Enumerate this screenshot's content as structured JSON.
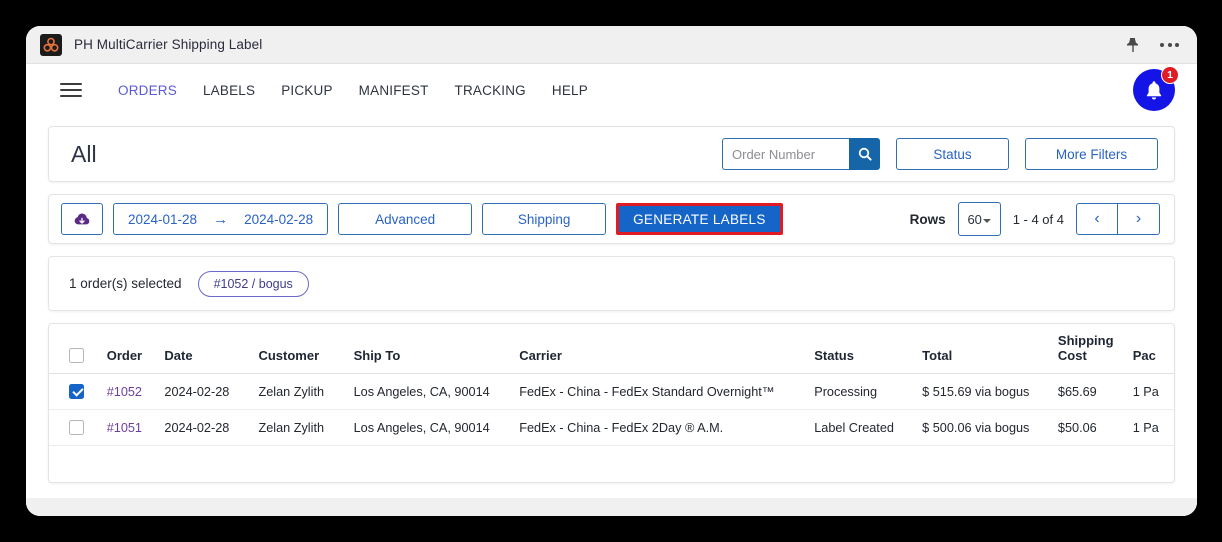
{
  "titlebar": {
    "app_icon": "trefoil-app-icon",
    "title": "PH MultiCarrier Shipping Label",
    "pin_icon": "pin-icon",
    "more_icon": "more-options-icon"
  },
  "nav": {
    "menu_icon": "hamburger-menu-icon",
    "items": [
      {
        "label": "ORDERS",
        "active": true
      },
      {
        "label": "LABELS",
        "active": false
      },
      {
        "label": "PICKUP",
        "active": false
      },
      {
        "label": "MANIFEST",
        "active": false
      },
      {
        "label": "TRACKING",
        "active": false
      },
      {
        "label": "HELP",
        "active": false
      }
    ],
    "notification": {
      "icon": "bell-icon",
      "count": "1",
      "badge_color": "#e01b24",
      "circle_color": "#1414e6"
    }
  },
  "header": {
    "page_title": "All",
    "search": {
      "placeholder": "Order Number",
      "value": "",
      "icon": "search-icon"
    },
    "status_button": "Status",
    "more_filters_button": "More Filters"
  },
  "toolbar": {
    "export_icon": "cloud-download-icon",
    "date_from": "2024-01-28",
    "date_arrow": "→",
    "date_to": "2024-02-28",
    "advanced_button": "Advanced",
    "shipping_button": "Shipping",
    "generate_labels_button": "GENERATE LABELS",
    "generate_labels_highlight_color": "#e01b24",
    "generate_labels_bg_color": "#1565c8",
    "rows_label": "Rows",
    "rows_value": "60",
    "range_text": "1 - 4 of 4",
    "prev_icon": "chevron-left-icon",
    "next_icon": "chevron-right-icon"
  },
  "selection": {
    "text": "1 order(s) selected",
    "chips": [
      {
        "label": "#1052 / bogus"
      }
    ]
  },
  "table": {
    "columns": [
      "Order",
      "Date",
      "Customer",
      "Ship To",
      "Carrier",
      "Status",
      "Total",
      "Shipping Cost",
      "Pac"
    ],
    "rows": [
      {
        "selected": true,
        "order": "#1052",
        "date": "2024-02-28",
        "customer": "Zelan Zylith",
        "ship_to": "Los Angeles, CA, 90014",
        "carrier": "FedEx - China - FedEx Standard Overnight™",
        "status": "Processing",
        "total": "$ 515.69 via bogus",
        "shipping_cost": "$65.69",
        "packages": "1 Pa"
      },
      {
        "selected": false,
        "order": "#1051",
        "date": "2024-02-28",
        "customer": "Zelan Zylith",
        "ship_to": "Los Angeles, CA, 90014",
        "carrier": "FedEx - China - FedEx 2Day ® A.M.",
        "status": "Label Created",
        "total": "$ 500.06 via bogus",
        "shipping_cost": "$50.06",
        "packages": "1 Pa"
      }
    ]
  }
}
